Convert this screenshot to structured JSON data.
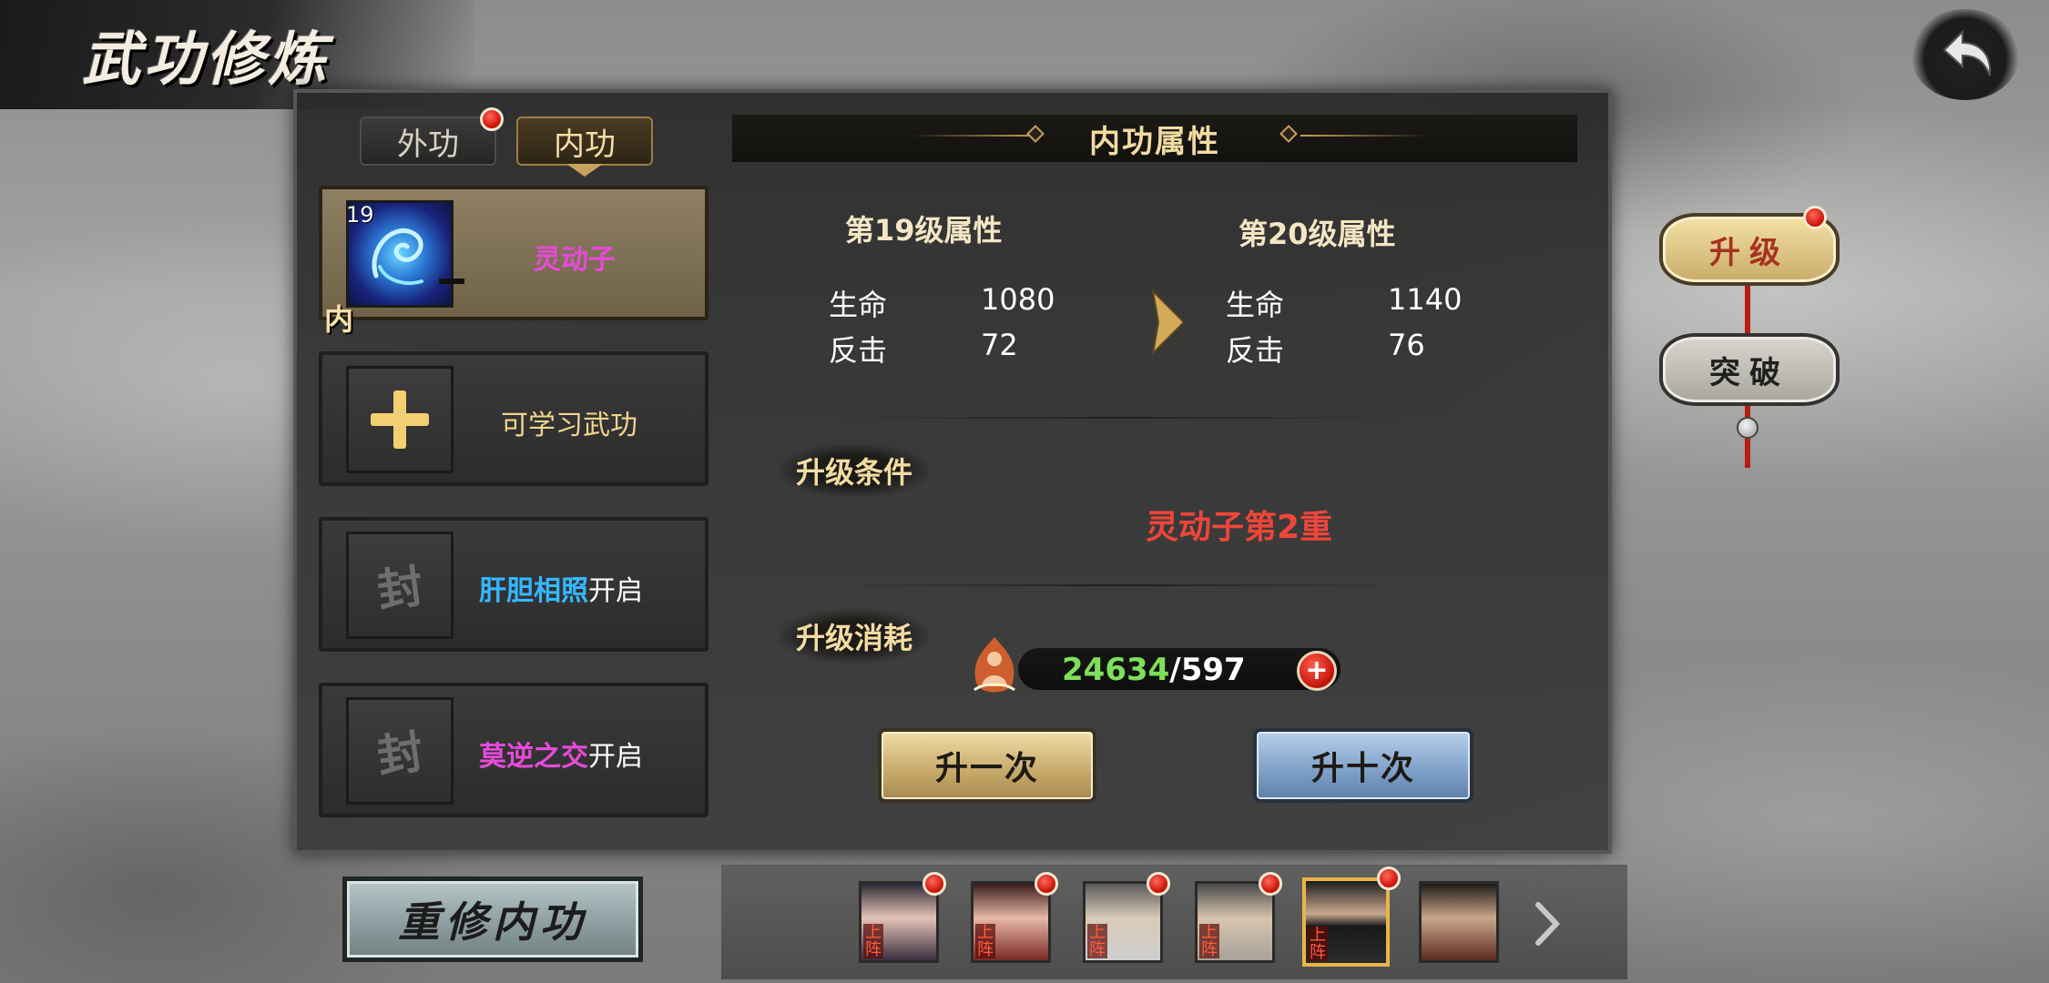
{
  "header": {
    "title": "武功修炼"
  },
  "tabs": [
    {
      "label": "外功",
      "has_badge": true
    },
    {
      "label": "内功",
      "has_badge": false,
      "active": true
    }
  ],
  "skill_list": [
    {
      "level": "19",
      "name": "灵动子",
      "type_char": "内",
      "name_color": "#e64bd8",
      "selected": true,
      "icon": "swirl-orb-icon"
    },
    {
      "name": "可学习武功",
      "icon": "plus-icon"
    },
    {
      "seal": "封",
      "name": "肝胆相照",
      "name_color": "#35b8ff",
      "suffix": "开启",
      "icon": "seal-icon"
    },
    {
      "seal": "封",
      "name": "莫逆之交",
      "name_color": "#e64bd8",
      "suffix": "开启",
      "icon": "seal-icon"
    }
  ],
  "panel": {
    "title": "内功属性",
    "current": {
      "title": "第19级属性",
      "stats": [
        {
          "label": "生命",
          "value": "1080"
        },
        {
          "label": "反击",
          "value": "72"
        }
      ]
    },
    "next": {
      "title": "第20级属性",
      "stats": [
        {
          "label": "生命",
          "value": "1140"
        },
        {
          "label": "反击",
          "value": "76"
        }
      ]
    },
    "condition_label": "升级条件",
    "condition_text": "灵动子第2重",
    "cost_label": "升级消耗",
    "cost_have": "24634",
    "cost_need": "/597",
    "cost_icon": "meditating-figure-icon",
    "btn_once": "升一次",
    "btn_ten": "升十次"
  },
  "side": {
    "upgrade": "升级",
    "breakthrough": "突破",
    "upgrade_badge": true
  },
  "bottom": {
    "reset": "重修内功",
    "heroes": [
      {
        "tag": "上阵",
        "badge": true,
        "icon": "hero-portrait-woman-icon"
      },
      {
        "tag": "上阵",
        "badge": true,
        "icon": "hero-portrait-woman-red-icon"
      },
      {
        "tag": "上阵",
        "badge": true,
        "icon": "hero-portrait-elder-icon"
      },
      {
        "tag": "上阵",
        "badge": true,
        "icon": "hero-portrait-elder-2-icon"
      },
      {
        "tag": "上阵",
        "badge": true,
        "active": true,
        "icon": "hero-portrait-masked-icon"
      },
      {
        "tag": "",
        "badge": false,
        "icon": "hero-portrait-swordsman-icon"
      }
    ]
  },
  "colors": {
    "gold": "#f3dca2",
    "red": "#f0453a",
    "green": "#7ee05a",
    "magenta": "#e64bd8",
    "cyan": "#35b8ff"
  }
}
